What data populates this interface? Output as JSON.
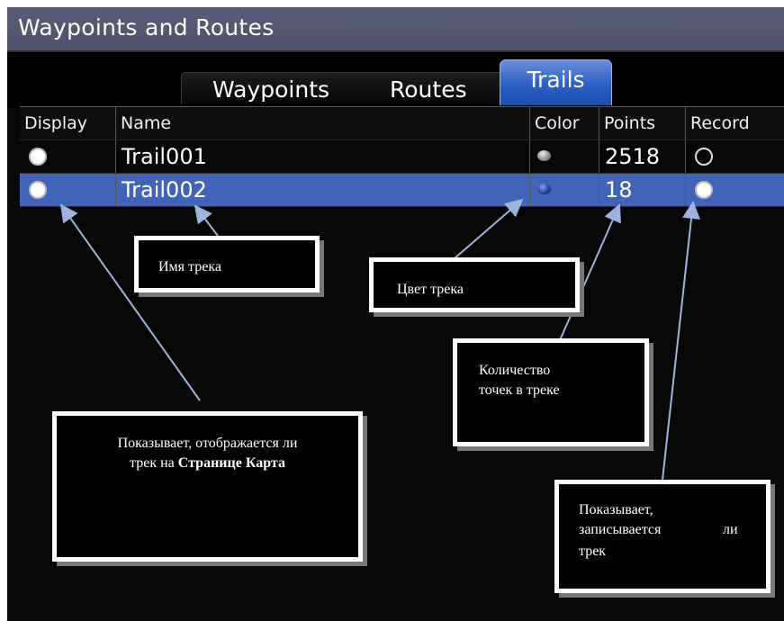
{
  "window": {
    "title": "Waypoints and Routes"
  },
  "tabs": {
    "waypoints": "Waypoints",
    "routes": "Routes",
    "trails": "Trails",
    "active": "Trails"
  },
  "table": {
    "headers": [
      "Display",
      "Name",
      "Color",
      "Points",
      "Record"
    ],
    "rows": [
      {
        "display": "on",
        "name": "Trail001",
        "color": "#9a9a9a",
        "points": "2518",
        "record": "off",
        "selected": false
      },
      {
        "display": "on",
        "name": "Trail002",
        "color": "#2a3f9e",
        "points": "18",
        "record": "on",
        "selected": true
      }
    ]
  },
  "callouts": {
    "name": "Имя трека",
    "color": "Цвет трека",
    "points_line1": "Количество",
    "points_line2": "точек в треке",
    "display_line1": "Показывает, отображается ли",
    "display_line2_pre": "трек на ",
    "display_line2_bold": "Странице Карта",
    "record_line1": "Показывает,",
    "record_line2a": "записывается",
    "record_line2b": "ли",
    "record_line3": "трек"
  },
  "colors": {
    "title_bar": "#55587a",
    "selection": "#4264b8",
    "active_tab": "#3a68cc",
    "arrow": "#9bb3dd"
  }
}
